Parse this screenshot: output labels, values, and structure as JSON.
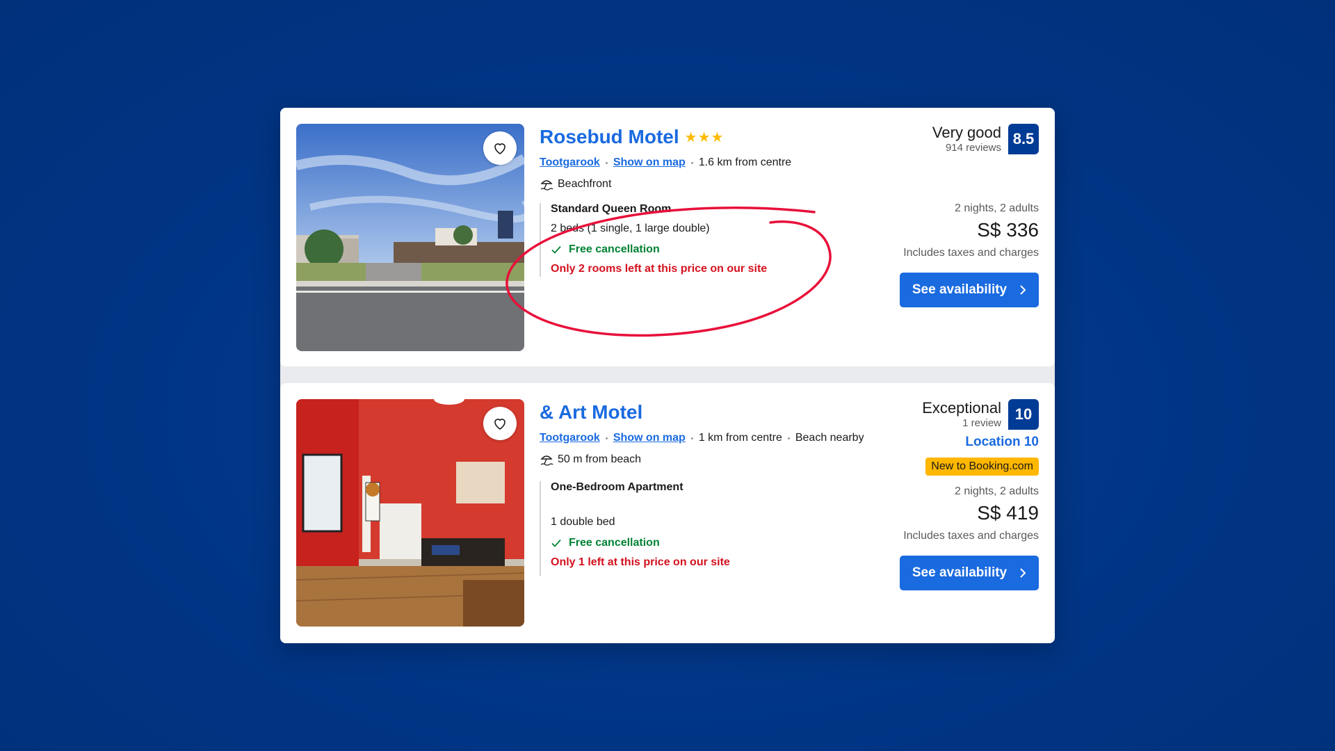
{
  "listings": [
    {
      "name": "Rosebud Motel",
      "stars": "★★★",
      "area": "Tootgarook",
      "map_link": "Show on map",
      "distance": "1.6 km from centre",
      "extra": "",
      "feature": "Beachfront",
      "room_name": "Standard Queen Room",
      "beds": "2 beds (1 single, 1 large double)",
      "cancellation": "Free cancellation",
      "scarcity": "Only 2 rooms left at this price on our site",
      "rating_word": "Very good",
      "reviews": "914 reviews",
      "score": "8.5",
      "stay": "2 nights, 2 adults",
      "price": "S$ 336",
      "taxes": "Includes taxes and charges",
      "button": "See availability"
    },
    {
      "name": "& Art Motel",
      "area": "Tootgarook",
      "map_link": "Show on map",
      "distance": "1 km from centre",
      "extra": "Beach nearby",
      "feature": "50 m from beach",
      "room_name": "One-Bedroom Apartment",
      "beds": "1 double bed",
      "cancellation": "Free cancellation",
      "scarcity": "Only 1 left at this price on our site",
      "rating_word": "Exceptional",
      "reviews": "1 review",
      "score": "10",
      "location_score": "Location 10",
      "badge": "New to Booking.com",
      "stay": "2 nights, 2 adults",
      "price": "S$ 419",
      "taxes": "Includes taxes and charges",
      "button": "See availability"
    }
  ],
  "colors": {
    "background": "#003585",
    "link_blue": "#1a6ae0",
    "score_navy": "#003b95",
    "free_green": "#008234",
    "scarcity_red": "#d4111e",
    "badge_yellow": "#ffb700",
    "annotation_red": "#e8103a"
  },
  "icons": {
    "favorite": "heart-outline-icon",
    "beach": "beach-umbrella-icon",
    "check": "checkmark-icon",
    "chevron": "chevron-right-icon"
  }
}
